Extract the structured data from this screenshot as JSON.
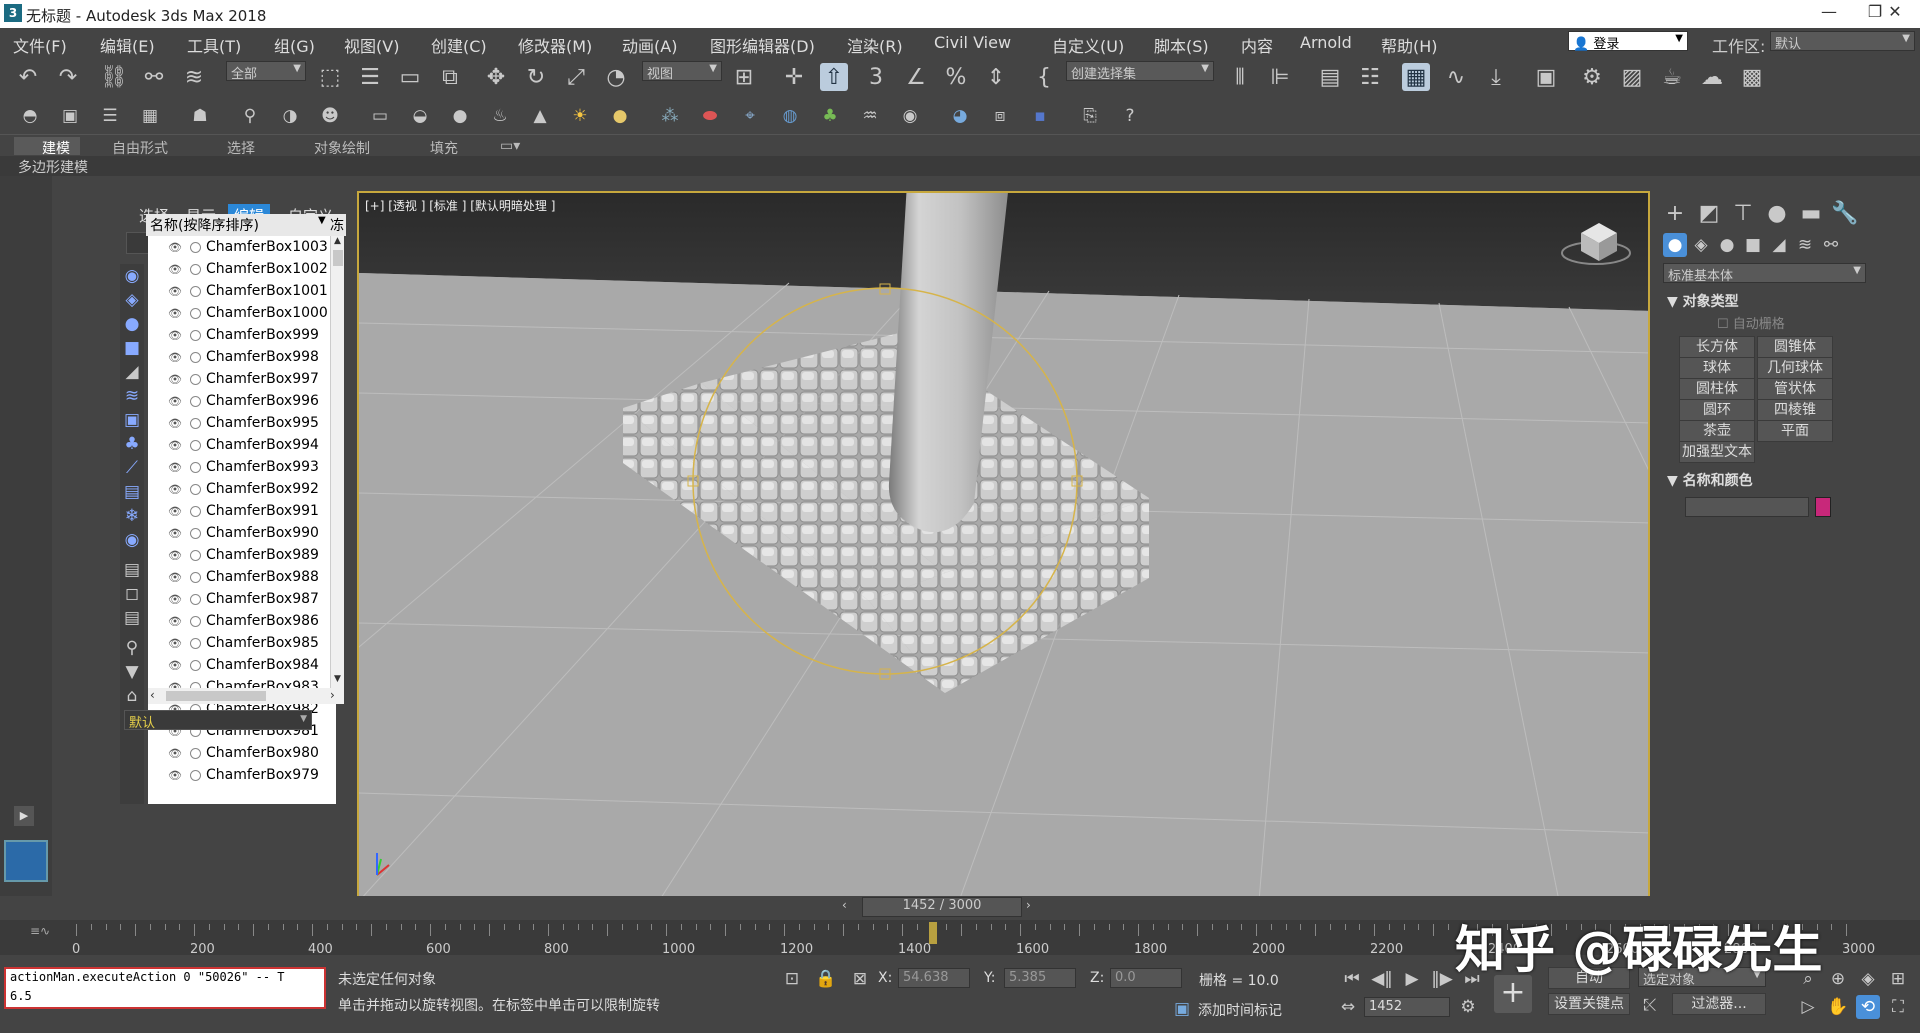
{
  "window": {
    "title": "无标题 - Autodesk 3ds Max 2018",
    "app_icon": "3",
    "minimize": "—",
    "maximize": "❐",
    "close": "✕"
  },
  "menu": [
    "文件(F)",
    "编辑(E)",
    "工具(T)",
    "组(G)",
    "视图(V)",
    "创建(C)",
    "修改器(M)",
    "动画(A)",
    "图形编辑器(D)",
    "渲染(R)",
    "Civil View",
    "自定义(U)",
    "脚本(S)",
    "内容",
    "Arnold",
    "帮助(H)"
  ],
  "login": "登录",
  "workspace": {
    "label": "工作区:",
    "value": "默认"
  },
  "toolbar": {
    "filter_all": "全部",
    "ref_coord": "视图",
    "selection_set": "创建选择集"
  },
  "ribbon": {
    "tabs": [
      "建模",
      "自由形式",
      "选择",
      "对象绘制",
      "填充"
    ],
    "sub": "多边形建模"
  },
  "scene_explorer": {
    "tabs": [
      "选择",
      "显示",
      "编辑",
      "自定义"
    ],
    "active_tab": "编辑",
    "column_header": "名称(按降序排序)",
    "frozen_col": "冻",
    "layer": "默认",
    "items": [
      "ChamferBox1003",
      "ChamferBox1002",
      "ChamferBox1001",
      "ChamferBox1000",
      "ChamferBox999",
      "ChamferBox998",
      "ChamferBox997",
      "ChamferBox996",
      "ChamferBox995",
      "ChamferBox994",
      "ChamferBox993",
      "ChamferBox992",
      "ChamferBox991",
      "ChamferBox990",
      "ChamferBox989",
      "ChamferBox988",
      "ChamferBox987",
      "ChamferBox986",
      "ChamferBox985",
      "ChamferBox984",
      "ChamferBox983",
      "ChamferBox982",
      "ChamferBox981",
      "ChamferBox980",
      "ChamferBox979"
    ]
  },
  "viewport": {
    "label": "[+] [透视 ] [标准 ] [默认明暗处理 ]"
  },
  "command_panel": {
    "category": "标准基本体",
    "rollout_object_type": "对象类型",
    "autogrid": "自动栅格",
    "buttons": [
      "长方体",
      "圆锥体",
      "球体",
      "几何球体",
      "圆柱体",
      "管状体",
      "圆环",
      "四棱锥",
      "茶壶",
      "平面",
      "加强型文本"
    ],
    "rollout_name_color": "名称和颜色",
    "swatch_color": "#c8287a"
  },
  "timeline": {
    "frame_display": "1452 / 3000",
    "current_frame": 1452,
    "total_frames": 3000,
    "ticks": [
      "0",
      "200",
      "400",
      "600",
      "800",
      "1000",
      "1200",
      "1400",
      "1600",
      "1800",
      "2000",
      "2200",
      "2400",
      "2600",
      "2800",
      "3000"
    ]
  },
  "status": {
    "maxscript_line1": "actionMan.executeAction 0 \"50026\"  -- T",
    "maxscript_line2": "6.5",
    "selection": "未选定任何对象",
    "prompt": "单击并拖动以旋转视图。在标签中单击可以限制旋转",
    "x_label": "X:",
    "x": "54.638",
    "y_label": "Y:",
    "y": "5.385",
    "z_label": "Z:",
    "z": "0.0",
    "grid": "栅格 = 10.0",
    "add_time_tag": "添加时间标记",
    "auto_key": "自动",
    "selected": "选定对象",
    "set_key": "设置关键点",
    "filters": "过滤器...",
    "frame_field": "1452"
  },
  "watermark": "知乎 @碌碌先生"
}
